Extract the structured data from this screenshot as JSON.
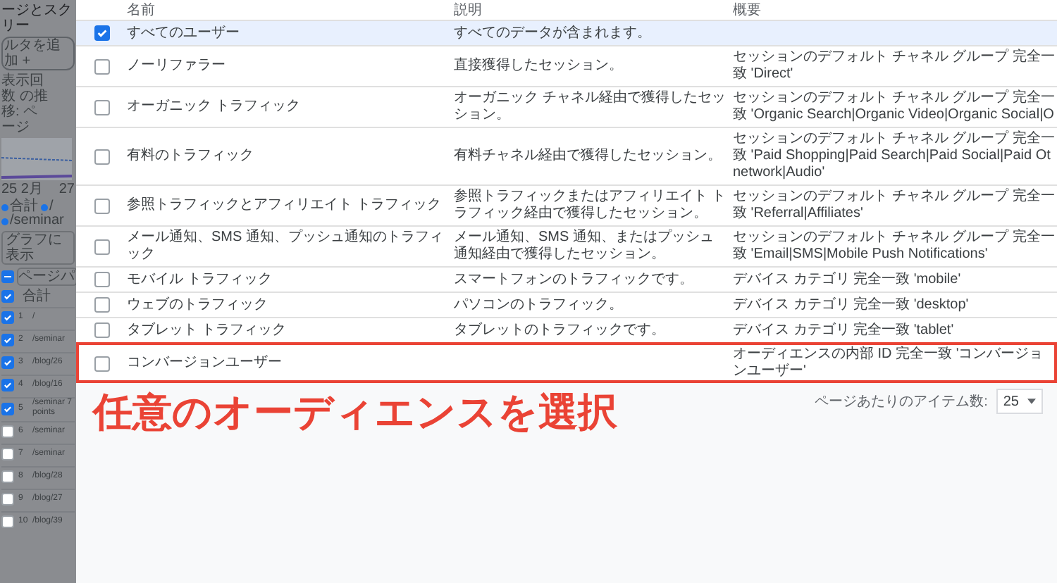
{
  "background_page": {
    "title": "ージとスクリー",
    "filter_chip": "ルタを追加 +",
    "chart_title": "表示回数 の推移: ページ",
    "axis_labels": [
      "25 2月",
      "27"
    ],
    "legend": [
      {
        "label": "合計",
        "color": "#1a73e8"
      },
      {
        "label": "/",
        "color": "#1a73e8"
      },
      {
        "label": "/seminar",
        "color": "#1a73e8"
      }
    ],
    "chart_button": "グラフに表示",
    "select_all_indeterminate": true,
    "search_placeholder": "ページパ",
    "total_label": "合計",
    "total_checked": true,
    "rows": [
      {
        "rank": "1",
        "path": "/",
        "checked": true
      },
      {
        "rank": "2",
        "path": "/seminar",
        "checked": true
      },
      {
        "rank": "3",
        "path": "/blog/26",
        "checked": true
      },
      {
        "rank": "4",
        "path": "/blog/16",
        "checked": true
      },
      {
        "rank": "5",
        "path": "/seminar 7points",
        "checked": true
      },
      {
        "rank": "6",
        "path": "/seminar",
        "checked": false
      },
      {
        "rank": "7",
        "path": "/seminar",
        "checked": false
      },
      {
        "rank": "8",
        "path": "/blog/28",
        "checked": false
      },
      {
        "rank": "9",
        "path": "/blog/27",
        "checked": false
      },
      {
        "rank": "10",
        "path": "/blog/39",
        "checked": false
      }
    ]
  },
  "audience_table": {
    "columns": [
      "名前",
      "説明",
      "概要"
    ],
    "rows": [
      {
        "name": "すべてのユーザー",
        "description": "すべてのデータが含まれます。",
        "checked": true,
        "annotated": false
      },
      {
        "name": "ノーリファラー",
        "description": "直接獲得したセッション。",
        "summary": "セッションのデフォルト チャネル グループ 完全一致 'Direct'",
        "checked": false,
        "annotated": false
      },
      {
        "name": "オーガニック トラフィック",
        "description": "オーガニック チャネル経由で獲得したセッション。",
        "summary": "セッションのデフォルト チャネル グループ 完全一致 'Organic Search|Organic Video|Organic Social|O",
        "checked": false,
        "annotated": false
      },
      {
        "name": "有料のトラフィック",
        "description": "有料チャネル経由で獲得したセッション。",
        "summary": "セッションのデフォルト チャネル グループ 完全一致 'Paid Shopping|Paid Search|Paid Social|Paid Ot network|Audio'",
        "checked": false,
        "annotated": false
      },
      {
        "name": "参照トラフィックとアフィリエイト トラフィック",
        "description": "参照トラフィックまたはアフィリエイト トラフィック経由で獲得したセッション。",
        "summary": "セッションのデフォルト チャネル グループ 完全一致 'Referral|Affiliates'",
        "checked": false,
        "annotated": false
      },
      {
        "name": "メール通知、SMS 通知、プッシュ通知のトラフィック",
        "description": "メール通知、SMS 通知、またはプッシュ通知経由で獲得したセッション。",
        "summary": "セッションのデフォルト チャネル グループ 完全一致 'Email|SMS|Mobile Push Notifications'",
        "checked": false,
        "annotated": false
      },
      {
        "name": "モバイル トラフィック",
        "description": "スマートフォンのトラフィックです。",
        "summary": "デバイス カテゴリ 完全一致 'mobile'",
        "checked": false,
        "annotated": false
      },
      {
        "name": "ウェブのトラフィック",
        "description": "パソコンのトラフィック。",
        "summary": "デバイス カテゴリ 完全一致 'desktop'",
        "checked": false,
        "annotated": false
      },
      {
        "name": "タブレット トラフィック",
        "description": "タブレットのトラフィックです。",
        "summary": "デバイス カテゴリ 完全一致 'tablet'",
        "checked": false,
        "annotated": false
      },
      {
        "name": "コンバージョンユーザー",
        "summary": "オーディエンスの内部 ID 完全一致 'コンバージョンユーザー'",
        "checked": false,
        "annotated": true
      }
    ]
  },
  "annotation": {
    "text": "任意のオーディエンスを選択"
  },
  "pagination": {
    "label": "ページあたりのアイテム数:",
    "value": "25"
  }
}
